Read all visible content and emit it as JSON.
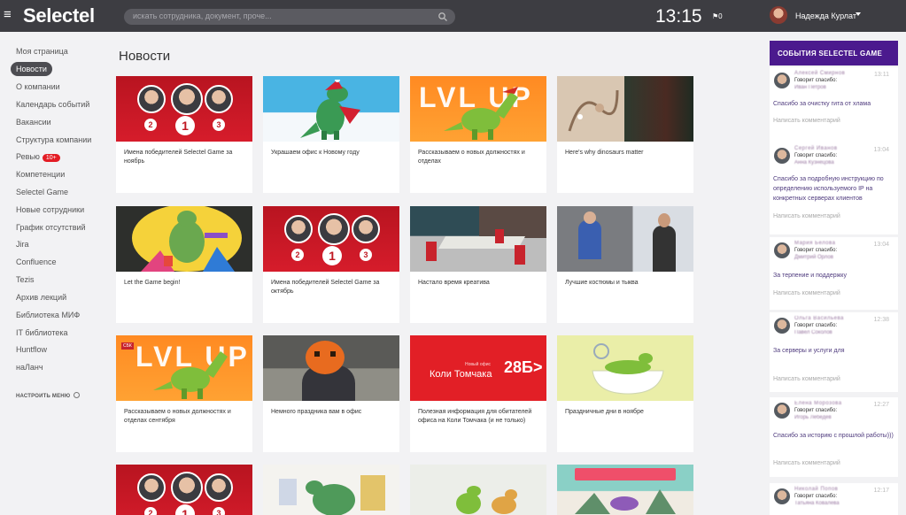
{
  "header": {
    "logo": "Selectel",
    "search_placeholder": "искать сотрудника, документ, проче...",
    "time": "13:15",
    "flag_label": "0",
    "user_name": "Надежда Курлат"
  },
  "sidebar": {
    "items": [
      {
        "label": "Моя страница"
      },
      {
        "label": "Новости",
        "active": true
      },
      {
        "label": "О компании"
      },
      {
        "label": "Календарь событий"
      },
      {
        "label": "Вакансии"
      },
      {
        "label": "Структура компании"
      },
      {
        "label": "Ревью",
        "badge": "10+"
      },
      {
        "label": "Компетенции"
      },
      {
        "label": "Selectel Game"
      },
      {
        "label": "Новые сотрудники"
      },
      {
        "label": "График отсутствий"
      },
      {
        "label": "Jira"
      },
      {
        "label": "Confluence"
      },
      {
        "label": "Tezis"
      },
      {
        "label": "Архив лекций"
      },
      {
        "label": "Библиотека МИФ"
      },
      {
        "label": "IT библиотека"
      },
      {
        "label": "Huntflow"
      },
      {
        "label": "наЛанч"
      }
    ],
    "settings_label": "НАСТРОИТЬ МЕНЮ"
  },
  "main": {
    "title": "Новости",
    "cards": [
      {
        "title": "Имена победителей Selectel Game за ноябрь",
        "medals": [
          "2",
          "1",
          "3"
        ]
      },
      {
        "title": "Украшаем офис к Новому году"
      },
      {
        "title": "Рассказываем о новых должностях и отделах",
        "thumb_text": "LVL UP"
      },
      {
        "title": "Here's why dinosaurs matter"
      },
      {
        "title": "Let the Game begin!"
      },
      {
        "title": "Имена победителей Selectel Game за октябрь",
        "medals": [
          "2",
          "1",
          "3"
        ]
      },
      {
        "title": "Настало время креатива"
      },
      {
        "title": "Лучшие костюмы и тыква"
      },
      {
        "title": "Рассказываем о новых должностях и отделах сентября",
        "thumb_text": "LVL UP",
        "thumb_tag": "СБК"
      },
      {
        "title": "Немного праздника вам в офис"
      },
      {
        "title": "Полезная информация для обитателей офиса на Коли Томчака (и не только)",
        "banner_small": "Новый офис",
        "banner_title": "Коли Томчака",
        "banner_num": "28Б>"
      },
      {
        "title": "Праздничные дни в ноябре"
      },
      {
        "title": "",
        "medals": [
          "2",
          "1",
          "3"
        ]
      },
      {
        "title": ""
      },
      {
        "title": ""
      },
      {
        "title": ""
      }
    ]
  },
  "events": {
    "title": "СОБЫТИЯ SELECTEL GAME",
    "comment_link": "Написать комментарий",
    "items": [
      {
        "author": "Алексей Смирнов",
        "time": "13:11",
        "says": "Говорит спасибо:",
        "target": "Иван Петров",
        "text": "Спасибо за очистку гита от хлама"
      },
      {
        "author": "Сергей Иванов",
        "time": "13:04",
        "says": "Говорит спасибо:",
        "target": "Анна Кузнецова",
        "text": "Спасибо за подробную инструкцию по определению используемого IP на конкретных серверах клиентов"
      },
      {
        "author": "Мария Белова",
        "time": "13:04",
        "says": "Говорит спасибо:",
        "target": "Дмитрий Орлов",
        "text": "За терпение и поддержку"
      },
      {
        "author": "Ольга Васильева",
        "time": "12:38",
        "says": "Говорит спасибо:",
        "target": "Павел Соколов",
        "text": "За серверы и услуги для"
      },
      {
        "author": "Елена Морозова",
        "time": "12:27",
        "says": "Говорит спасибо:",
        "target": "Игорь Лебедев",
        "text": "Спасибо за историю с прошлой работы)))"
      },
      {
        "author": "Николай Попов",
        "time": "12:17",
        "says": "Говорит спасибо:",
        "target": "Татьяна Ковалева",
        "text": ""
      }
    ]
  }
}
